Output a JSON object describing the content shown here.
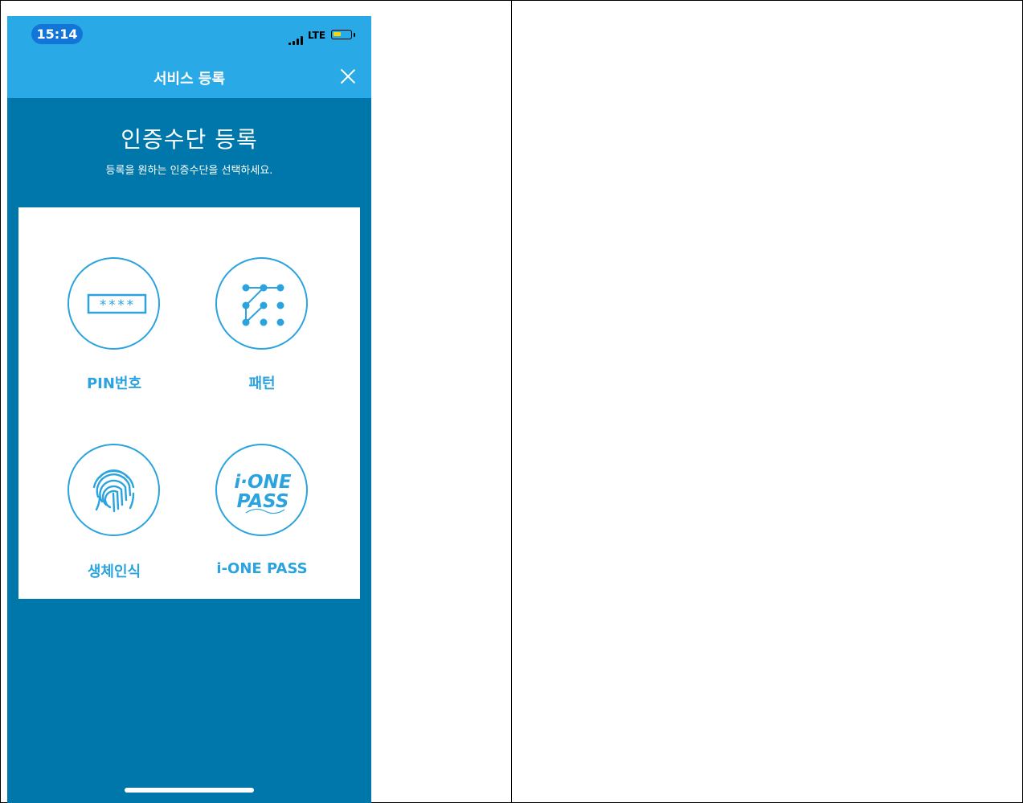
{
  "status_bar": {
    "time": "15:14",
    "network": "LTE",
    "battery_level_percent": 45,
    "colors": {
      "bar": "#29a9e6",
      "time_pill": "#1376d6",
      "battery": "#ffd60a"
    }
  },
  "header": {
    "title": "서비스 등록",
    "close_icon": "close-icon"
  },
  "main": {
    "heading": "인증수단 등록",
    "subheading": "등록을 원하는 인증수단을 선택하세요.",
    "background": "#0077aa",
    "options": [
      {
        "label": "PIN번호",
        "icon": "pin-keypad-icon",
        "icon_text": "****"
      },
      {
        "label": "패턴",
        "icon": "pattern-lock-icon"
      },
      {
        "label": "생체인식",
        "icon": "fingerprint-icon"
      },
      {
        "label": "i-ONE PASS",
        "icon": "i-one-pass-logo-icon",
        "logo_text_top": "i·ONE",
        "logo_text_bottom": "PASS"
      }
    ],
    "accent": "#2aa3de"
  }
}
